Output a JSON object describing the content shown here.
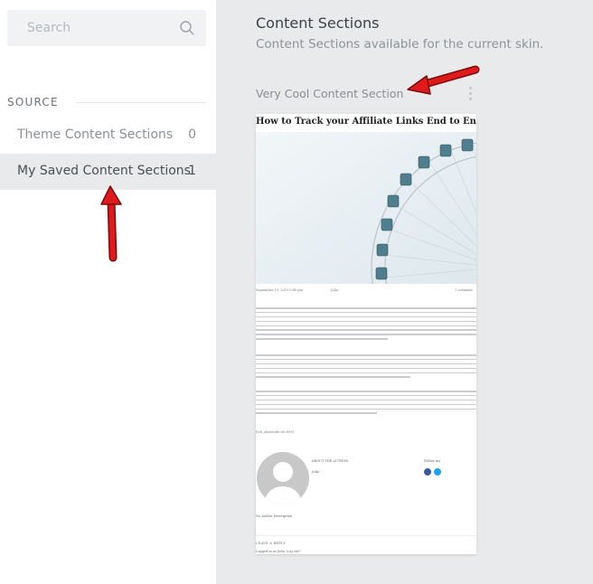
{
  "search": {
    "placeholder": "Search",
    "value": ""
  },
  "sidebar": {
    "source_heading": "SOURCE",
    "items": [
      {
        "label": "Theme Content Sections",
        "count": "0",
        "selected": false
      },
      {
        "label": "My Saved Content Sections",
        "count": "1",
        "selected": true
      }
    ]
  },
  "main": {
    "title": "Content Sections",
    "subtitle": "Content Sections available for the current skin.",
    "section_name": "Very Cool Content Section"
  },
  "preview": {
    "post_title": "How to Track your Affiliate Links End to End",
    "meta_date": "September 19, 2019 9:49 pm",
    "meta_author": "Julia",
    "meta_comments": "1 comment",
    "shortcode": "[tcb_shortcode id=893]",
    "about_author": "ABOUT THE AUTHOR",
    "author_name": "Julia",
    "follow_me": "Follow me",
    "author_description": "No Author Description",
    "leave_reply": "LEAVE A REPLY",
    "logged_in": "Logged in as Julia. Log out?"
  },
  "colors": {
    "sidebar_bg": "#ffffff",
    "main_bg": "#e9eaeb",
    "selected_item_bg": "#e9eaeb",
    "annotation_arrow": "#e0191b"
  }
}
